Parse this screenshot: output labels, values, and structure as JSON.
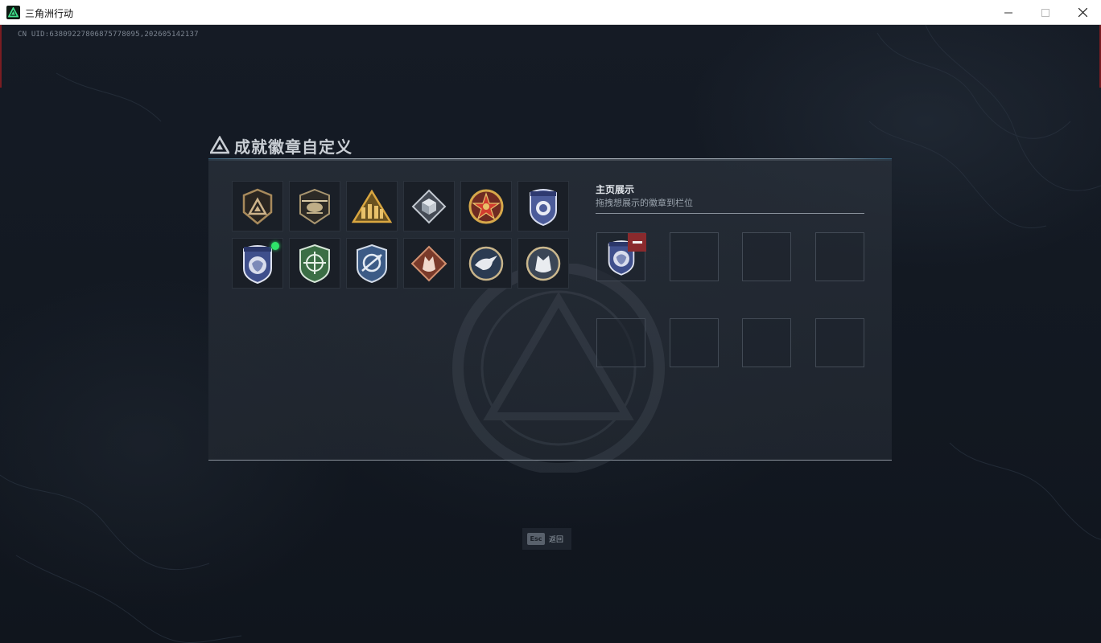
{
  "window": {
    "title": "三角洲行动",
    "icon": "delta-logo-icon",
    "controls": [
      "minimize-icon",
      "maximize-icon",
      "close-icon"
    ]
  },
  "uid_text": "CN UID:63809227806875778095,202605142137",
  "panel": {
    "title": "成就徽章自定义",
    "badges": [
      {
        "name": "bronze-shield-triangle-badge",
        "new": false
      },
      {
        "name": "helicopter-badge",
        "new": false
      },
      {
        "name": "gold-triangle-soldiers-badge",
        "new": false
      },
      {
        "name": "silver-diamond-cube-badge",
        "new": false
      },
      {
        "name": "red-star-medal-badge",
        "new": false
      },
      {
        "name": "blue-police-shield-badge",
        "new": false
      },
      {
        "name": "blue-lion-shield-badge",
        "new": true
      },
      {
        "name": "green-crosshair-shield-badge",
        "new": false
      },
      {
        "name": "blue-arrow-shield-badge",
        "new": false
      },
      {
        "name": "copper-wolf-diamond-badge",
        "new": false
      },
      {
        "name": "eagle-round-badge",
        "new": false
      },
      {
        "name": "wolf-round-badge",
        "new": false
      }
    ],
    "showcase": {
      "title": "主页展示",
      "subtitle": "拖拽想展示的徽章到栏位",
      "slots_filled": [
        "blue-lion-shield-badge"
      ],
      "slot_count": 8
    }
  },
  "footer": {
    "esc_key": "Esc",
    "esc_label": "返回"
  },
  "colors": {
    "background": "#141a24",
    "panel": "#262d37",
    "accent_green": "#2fe36a",
    "remove_red": "#8a2a2d",
    "title_text": "#c9ced4"
  }
}
